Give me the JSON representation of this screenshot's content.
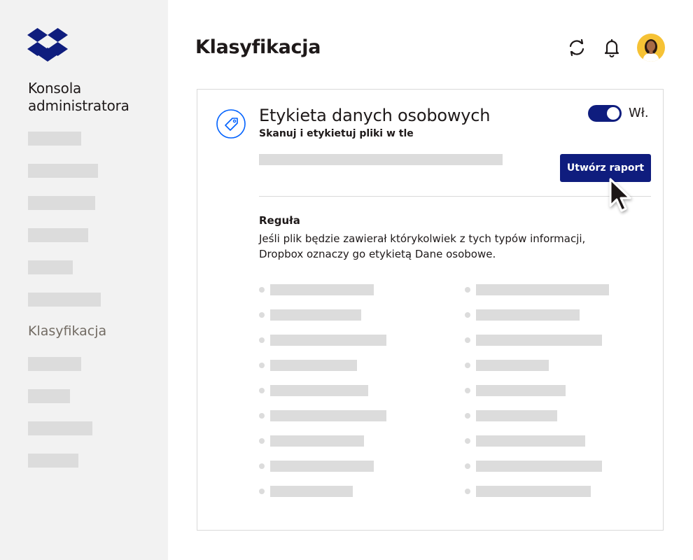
{
  "sidebar": {
    "console_title": "Konsola administratora",
    "active_item_label": "Klasyfikacja"
  },
  "header": {
    "title": "Klasyfikacja",
    "icons": [
      "sync-icon",
      "bell-icon",
      "user-avatar"
    ]
  },
  "card": {
    "title": "Etykieta danych osobowych",
    "subtitle": "Skanuj i etykietuj pliki w tle",
    "toggle_label": "Wł.",
    "toggle_on": true,
    "report_button_label": "Utwórz raport",
    "rule_heading": "Reguła",
    "rule_text_line1": "Jeśli plik będzie zawierał którykolwiek z tych typów informacji,",
    "rule_text_line2": "Dropbox oznaczy go etykietą Dane osobowe."
  },
  "colors": {
    "brand": "#0061fe",
    "accent": "#0f1d7e",
    "sidebar_bg": "#f2f2f2",
    "placeholder": "#dcdcdc",
    "text": "#1e1919",
    "muted_text": "#736c64"
  }
}
